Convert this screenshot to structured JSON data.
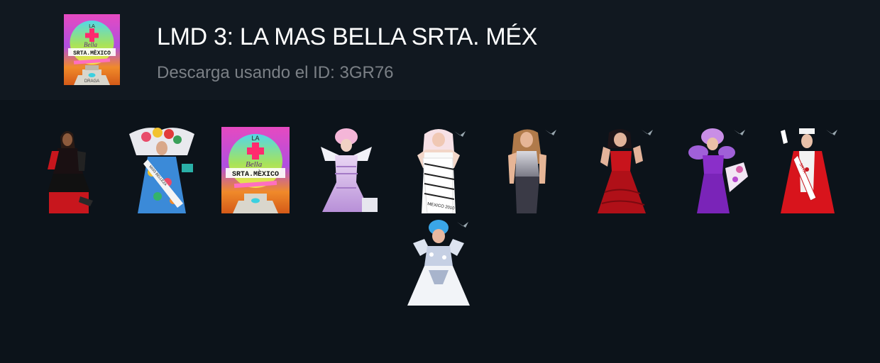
{
  "pack": {
    "title": "LMD 3: LA MAS BELLA SRTA. MÉX",
    "subtitle": "Descarga usando el ID: 3GR76",
    "cover_icon": "pack-cover-logo"
  },
  "logo_text": {
    "la": "LA",
    "bella": "Bella",
    "srta": "SRTA.MÈXICO",
    "brand": "DRAGA"
  },
  "sash_texts": {
    "s2": "MISS BELLEZA",
    "s5": "MEXICO 2010",
    "s9": "SRTA"
  },
  "stickers": [
    {
      "name": "queen-red-leather",
      "accent": "#c8161d"
    },
    {
      "name": "queen-flower-crown",
      "accent": "#e84c6a"
    },
    {
      "name": "la-bella-srta-mexico-logo",
      "accent": "#ff3e9d"
    },
    {
      "name": "queen-lilac-gown",
      "accent": "#c8a6e0"
    },
    {
      "name": "queen-white-sash",
      "accent": "#f2f2f2"
    },
    {
      "name": "queen-silver-dress",
      "accent": "#b9b9c2"
    },
    {
      "name": "queen-red-gown",
      "accent": "#c8141c"
    },
    {
      "name": "queen-purple-gown",
      "accent": "#8a2fc9"
    },
    {
      "name": "queen-red-cape-nurse",
      "accent": "#d8141c"
    },
    {
      "name": "queen-blue-hair-white-gown",
      "accent": "#3aa6e8"
    }
  ]
}
